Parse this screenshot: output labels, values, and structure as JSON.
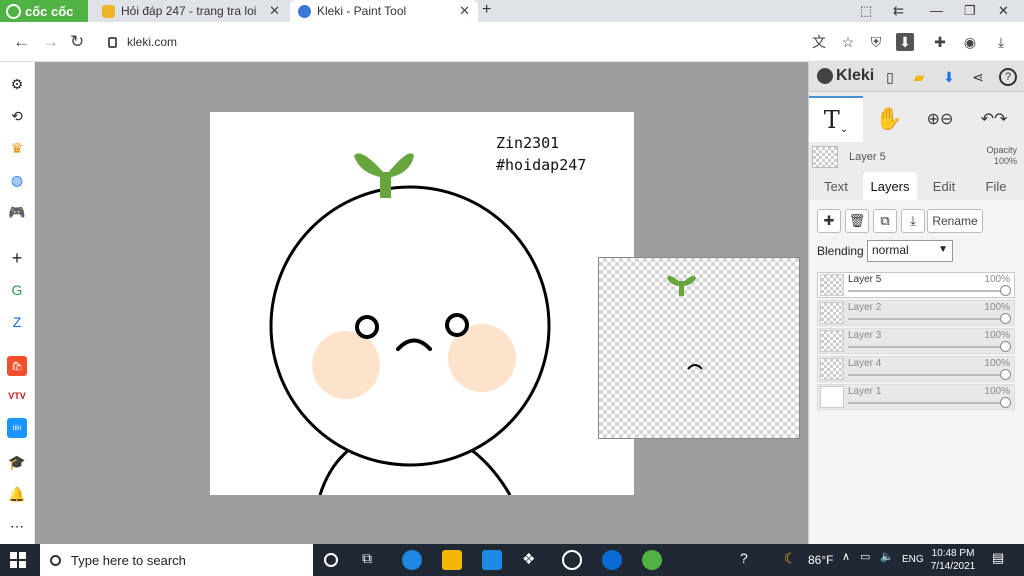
{
  "browser": {
    "brand": "cốc cốc",
    "tabs": [
      {
        "title": "Hỏi đáp 247 - trang tra loi",
        "active": false
      },
      {
        "title": "Kleki - Paint Tool",
        "active": true
      }
    ],
    "url": "kleki.com"
  },
  "canvas": {
    "text_line1": "Zin2301",
    "text_line2": "#hoidap247"
  },
  "panel": {
    "app_name": "Kleki",
    "current_layer": {
      "name": "Layer 5",
      "opacity_label": "Opacity",
      "opacity_value": "100%"
    },
    "tabs": [
      "Text",
      "Layers",
      "Edit",
      "File"
    ],
    "active_tab": "Layers",
    "rename_label": "Rename",
    "blending_label": "Blending",
    "blending_value": "normal",
    "layers": [
      {
        "name": "Layer 5",
        "opacity": "100%",
        "active": true
      },
      {
        "name": "Layer 2",
        "opacity": "100%",
        "active": false
      },
      {
        "name": "Layer 3",
        "opacity": "100%",
        "active": false
      },
      {
        "name": "Layer 4",
        "opacity": "100%",
        "active": false
      },
      {
        "name": "Layer 1",
        "opacity": "100%",
        "active": false
      }
    ]
  },
  "taskbar": {
    "search_placeholder": "Type here to search",
    "weather": "86°F",
    "language": "ENG",
    "time": "10:48 PM",
    "date": "7/14/2021"
  },
  "colors": {
    "accent_green": "#4fb242",
    "sprout_green": "#66a63c",
    "cheek": "#fde3cc",
    "taskbar": "#1f2833",
    "workspace": "#9e9e9e"
  }
}
